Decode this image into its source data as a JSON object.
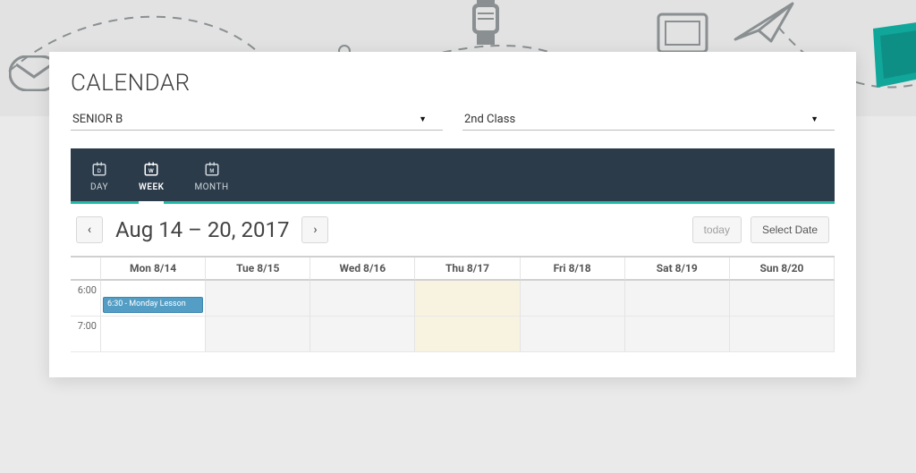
{
  "page_title": "CALENDAR",
  "filters": {
    "level": "SENIOR B",
    "class": "2nd Class"
  },
  "view_tabs": {
    "day": "DAY",
    "week": "WEEK",
    "month": "MONTH",
    "active": "week"
  },
  "date_range": "Aug 14 – 20, 2017",
  "buttons": {
    "today": "today",
    "select_date": "Select Date"
  },
  "days": [
    "Mon 8/14",
    "Tue 8/15",
    "Wed 8/16",
    "Thu 8/17",
    "Fri 8/18",
    "Sat 8/19",
    "Sun 8/20"
  ],
  "time_slots": [
    "6:00",
    "7:00"
  ],
  "today_col_index": 3,
  "events": [
    {
      "day_index": 0,
      "slot_index": 0,
      "label": "6:30 - Monday Lesson"
    }
  ]
}
